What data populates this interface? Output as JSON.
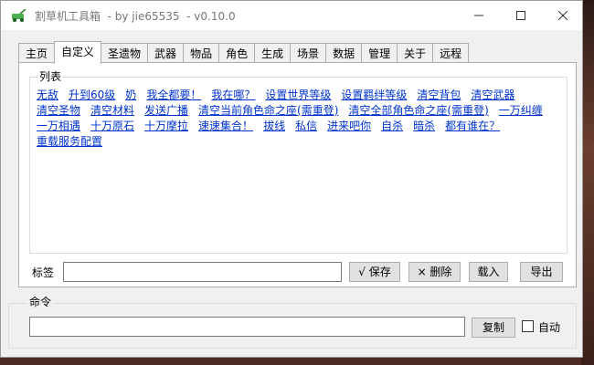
{
  "window": {
    "title": "割草机工具箱  - by jie65535  - v0.10.0",
    "controls": [
      "minimize-icon",
      "maximize-icon",
      "close-icon"
    ]
  },
  "tabs": [
    {
      "label": "主页",
      "active": false
    },
    {
      "label": "自定义",
      "active": true
    },
    {
      "label": "圣遗物",
      "active": false
    },
    {
      "label": "武器",
      "active": false
    },
    {
      "label": "物品",
      "active": false
    },
    {
      "label": "角色",
      "active": false
    },
    {
      "label": "生成",
      "active": false
    },
    {
      "label": "场景",
      "active": false
    },
    {
      "label": "数据",
      "active": false
    },
    {
      "label": "管理",
      "active": false
    },
    {
      "label": "关于",
      "active": false
    },
    {
      "label": "远程",
      "active": false
    }
  ],
  "list": {
    "title": "列表",
    "items": [
      "无敌",
      "升到60级",
      "奶",
      "我全都要！",
      "我在哪？",
      "设置世界等级",
      "设置羁绊等级",
      "清空背包",
      "清空武器",
      "清空圣物",
      "清空材料",
      "发送广播",
      "清空当前角色命之座(需重登)",
      "清空全部角色命之座(需重登)",
      "一万纠缠",
      "一万相遇",
      "十万原石",
      "十万摩拉",
      "速速集合！",
      "拔线",
      "私信",
      "进来吧你",
      "自杀",
      "暗杀",
      "都有谁在？",
      "重载服务配置"
    ]
  },
  "tag": {
    "label": "标签",
    "value": "",
    "save_label": "√ 保存",
    "delete_label": "× 删除",
    "import_label": "载入",
    "export_label": "导出"
  },
  "command": {
    "title": "命令",
    "value": "",
    "copy_label": "复制",
    "auto_label": "自动",
    "auto_checked": false
  }
}
